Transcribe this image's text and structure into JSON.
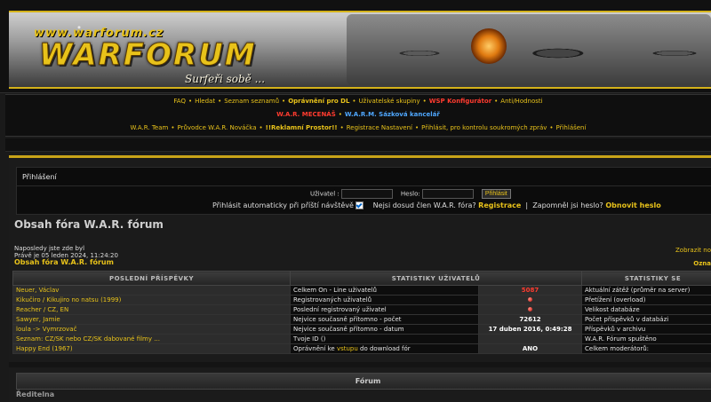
{
  "header": {
    "url_text": "www.warforum.cz",
    "logo_text": "WARFORUM",
    "slogan": "Surfeři sobě ..."
  },
  "nav": {
    "row1": [
      {
        "label": "FAQ",
        "style": "link"
      },
      {
        "label": "Hledat",
        "style": "link"
      },
      {
        "label": "Seznam seznamů",
        "style": "link"
      },
      {
        "label": "Oprávnění pro DL",
        "style": "bold"
      },
      {
        "label": "Uživatelské skupiny",
        "style": "link"
      },
      {
        "label": "WSP Konfigurátor",
        "style": "red"
      },
      {
        "label": "Anti/Hodnosti",
        "style": "link"
      }
    ],
    "row2": [
      {
        "label": "W.A.R. MECENÁŠ",
        "style": "red"
      },
      {
        "label": "W.A.R.M. Sázková kancelář",
        "style": "blue"
      }
    ],
    "row3": [
      {
        "label": "W.A.R. Team",
        "style": "link"
      },
      {
        "label": "Průvodce W.A.R. Nováčka",
        "style": "link"
      },
      {
        "label": "!!Reklamní Prostor!!",
        "style": "bold"
      },
      {
        "label": "Registrace Nastavení",
        "style": "link"
      },
      {
        "label": "Přihlásit, pro kontrolu soukromých zpráv",
        "style": "link"
      },
      {
        "label": "Přihlášení",
        "style": "link"
      }
    ]
  },
  "login": {
    "title": "Přihlášení",
    "username_label": "Uživatel :",
    "password_label": "Heslo:",
    "submit_label": "Přihlásit",
    "autologin_label": "Přihlásit automaticky při příští návštěvě",
    "not_member_text": "Nejsi dosud člen W.A.R. fóra?",
    "register_link": "Registrace",
    "forgot_text": "Zapomněl jsi heslo?",
    "new_password_link": "Obnovit heslo"
  },
  "main": {
    "page_title": "Obsah fóra W.A.R. fórum",
    "last_visit": "Naposledy jste zde byl",
    "now_time": "Právě je 05 leden 2024, 11:24:20",
    "breadcrumb": "Obsah fóra W.A.R. fórum",
    "right_link_1": "Zobrazit no",
    "right_link_2": "Ozna"
  },
  "stats": {
    "headers": [
      "POSLEDNÍ PŘÍSPĚVKY",
      "STATISTIKY UŽIVATELŮ",
      "",
      "STATISTIKY SE"
    ],
    "rows": [
      {
        "post": "Neuer, Václav",
        "label": "Celkem On - Line uživatelů",
        "value": "5087",
        "value_style": "red",
        "right": "Aktuální zátěž (průměr na server)"
      },
      {
        "post": "Kikučiro / Kikujiro no natsu (1999)",
        "label": "Registrovaných uživatelů",
        "value": "",
        "value_style": "dot",
        "right": "Přetížení (overload)"
      },
      {
        "post": "Reacher / CZ, EN",
        "label": "Poslední registrovaný uživatel",
        "value": "",
        "value_style": "dot",
        "right": "Velikost databáze"
      },
      {
        "post": "Sawyer, Jamie",
        "label": "Nejvice současně přítomno - počet",
        "value": "72612",
        "value_style": "plain",
        "right": "Počet příspěvků v databázi"
      },
      {
        "post": "loula -> Vymrzovač",
        "label": "Nejvice současně přítomno - datum",
        "value": "17 duben 2016, 0:49:28",
        "value_style": "plain",
        "right": "Příspěvků v archivu"
      },
      {
        "post": "Seznam: CZ/SK nebo CZ/SK dabované filmy ...",
        "label": "Tvoje ID ()",
        "value": "",
        "value_style": "plain",
        "right": "W.A.R. Fórum spuštěno"
      },
      {
        "post": "Happy End (1967)",
        "label_pre": "Oprávnění ke ",
        "label_link": "vstupu",
        "label_post": " do download fór",
        "value": "ANO",
        "value_style": "plain",
        "right": "Celkem moderátorů:"
      }
    ]
  },
  "forum": {
    "header": "Fórum",
    "section": "Ředitelna"
  },
  "colors": {
    "accent": "#e8c21a",
    "alert": "#ff3b2f",
    "link_blue": "#4fa7ff",
    "background": "#1a1a1a"
  }
}
